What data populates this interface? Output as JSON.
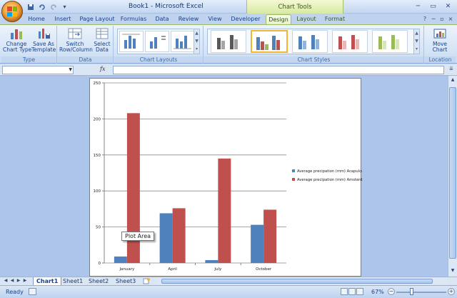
{
  "window": {
    "title": "Book1 - Microsoft Excel",
    "contextual_band": "Chart Tools"
  },
  "qat": {
    "save_icon": "save-icon",
    "undo_icon": "undo-icon",
    "redo_icon": "redo-icon",
    "customize_icon": "chevron-down-icon"
  },
  "tabs": [
    {
      "label": "Home"
    },
    {
      "label": "Insert"
    },
    {
      "label": "Page Layout"
    },
    {
      "label": "Formulas"
    },
    {
      "label": "Data"
    },
    {
      "label": "Review"
    },
    {
      "label": "View"
    },
    {
      "label": "Developer"
    },
    {
      "label": "Design"
    },
    {
      "label": "Layout"
    },
    {
      "label": "Format"
    }
  ],
  "active_tab": "Design",
  "ribbon": {
    "type_group": {
      "label": "Type",
      "change_chart_type": "Change\nChart Type",
      "save_as_template": "Save As\nTemplate"
    },
    "data_group": {
      "label": "Data",
      "switch_row_column": "Switch\nRow/Column",
      "select_data": "Select\nData"
    },
    "layouts_group": {
      "label": "Chart Layouts"
    },
    "styles_group": {
      "label": "Chart Styles"
    },
    "location_group": {
      "label": "Location",
      "move_chart": "Move\nChart"
    }
  },
  "formula_bar": {
    "name_box": "",
    "fx": "fx",
    "formula": ""
  },
  "chart_data": {
    "type": "bar",
    "categories": [
      "January",
      "April",
      "July",
      "October"
    ],
    "series": [
      {
        "name": "Average precipation (mm) Acapulco",
        "values": [
          9,
          69,
          4,
          53
        ],
        "color": "#4f81bd"
      },
      {
        "name": "Average precipation (mm) Amsterdam",
        "values": [
          208,
          76,
          145,
          74
        ],
        "color": "#c0504d"
      }
    ],
    "yticks": [
      0,
      50,
      100,
      150,
      200,
      250
    ],
    "ylim": [
      0,
      250
    ],
    "grid": true,
    "legend": "right"
  },
  "tooltip": "Plot Area",
  "sheet_tabs": [
    {
      "label": "Chart1"
    },
    {
      "label": "Sheet1"
    },
    {
      "label": "Sheet2"
    },
    {
      "label": "Sheet3"
    }
  ],
  "active_sheet": "Chart1",
  "status": {
    "mode": "Ready",
    "zoom": "67%",
    "zoom_level": 0.67
  }
}
